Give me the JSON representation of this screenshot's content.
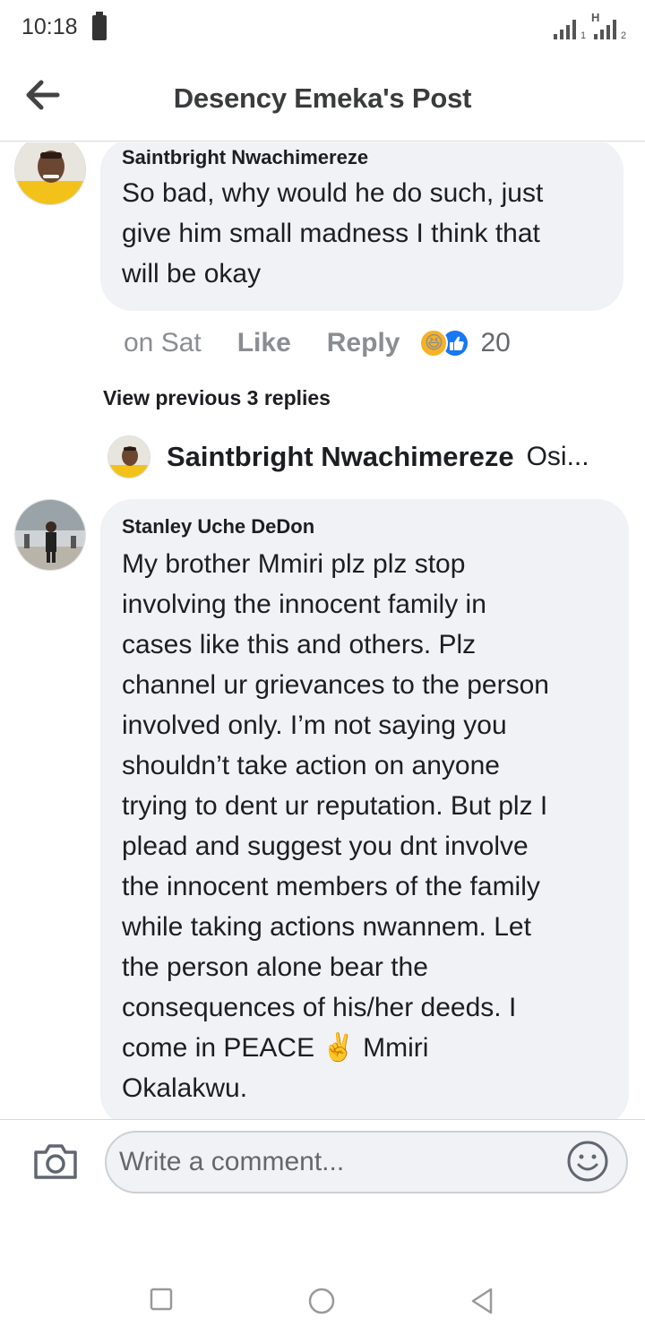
{
  "status_bar": {
    "time": "10:18",
    "signal_sub_1": "1",
    "signal_net": "H",
    "signal_sub_2": "2"
  },
  "header": {
    "title": "Desency Emeka's Post",
    "back_icon": "arrow-left-icon"
  },
  "comments": [
    {
      "author": "Saintbright Nwachimereze",
      "lines": [
        "So bad, why would he do such, just",
        "give him small madness I think that",
        "will be okay"
      ],
      "time": "on Sat",
      "like_label": "Like",
      "reply_label": "Reply",
      "reactions": [
        "haha-icon",
        "like-icon"
      ],
      "reaction_count": "20"
    },
    {
      "author": "Stanley Uche DeDon",
      "lines": [
        "My brother Mmiri plz plz stop",
        "involving the innocent family in",
        "cases  like this and others. Plz",
        "channel ur grievances to the person",
        "involved only. I’m not saying you",
        "shouldn’t take action on anyone",
        "trying to dent ur reputation. But plz I",
        "plead and suggest you dnt involve",
        "the innocent members of the family",
        "while taking actions nwannem. Let",
        "the person alone bear the",
        "consequences of his/her deeds. I",
        "come in PEACE ✌️ Mmiri",
        "Okalakwu."
      ]
    }
  ],
  "replies": {
    "view_previous": "View previous 3 replies",
    "latest_author": "Saintbright Nwachimereze",
    "latest_preview": "Osi..."
  },
  "composer": {
    "placeholder": "Write a comment...",
    "camera_icon": "camera-icon",
    "emoji_icon": "smiley-icon"
  },
  "nav": {
    "icons": [
      "recents-square-icon",
      "home-circle-icon",
      "back-triangle-icon"
    ]
  }
}
